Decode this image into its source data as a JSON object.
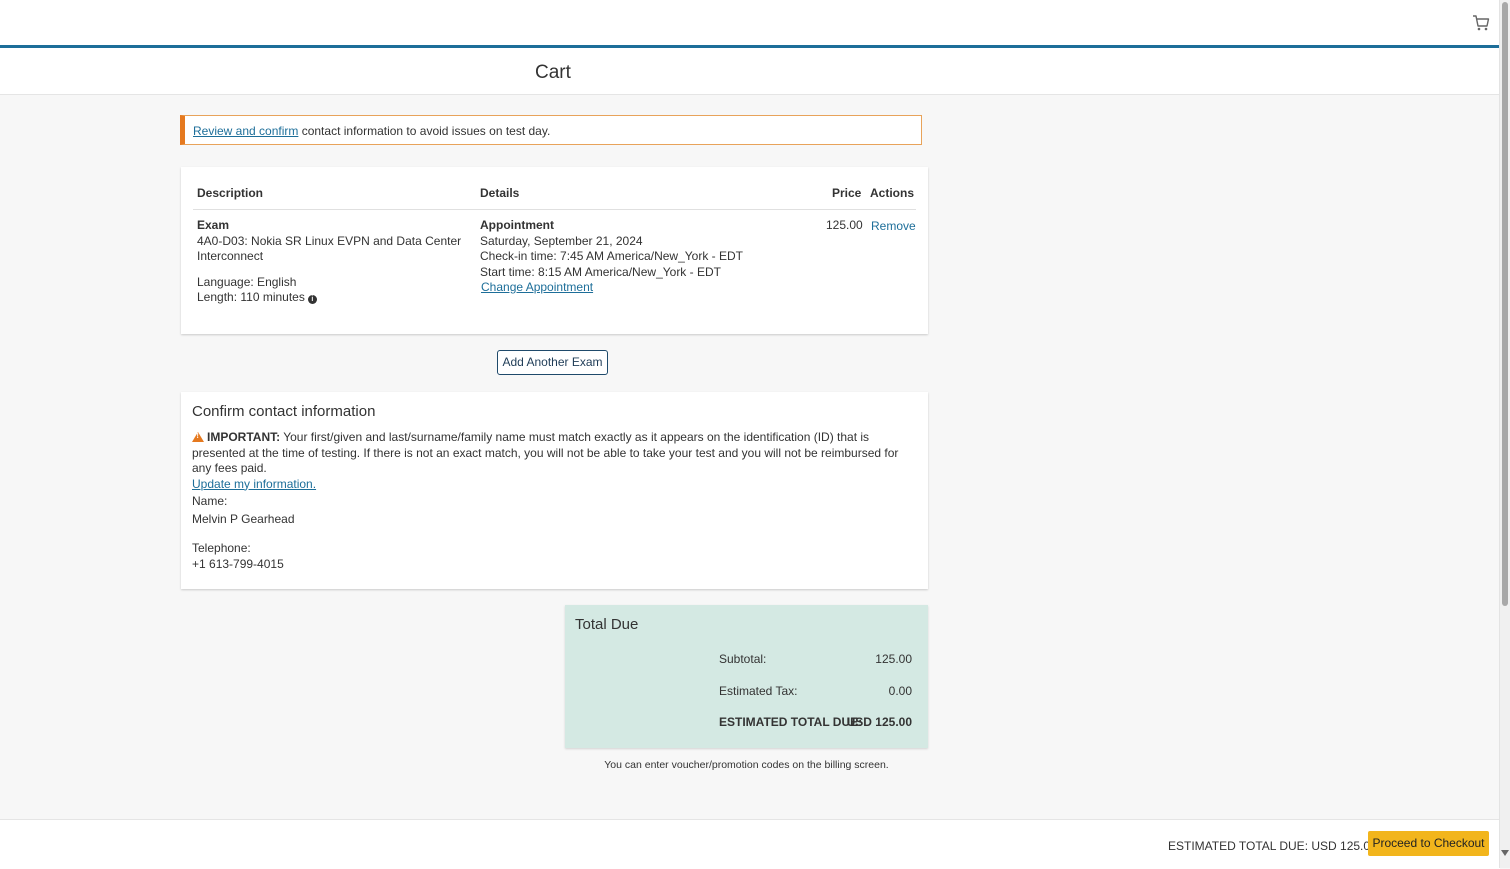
{
  "header": {
    "cart_icon": "shopping-cart-icon"
  },
  "page": {
    "title": "Cart"
  },
  "alert": {
    "link_text": "Review and confirm",
    "text": " contact information to avoid issues on test day."
  },
  "cart_table": {
    "headers": {
      "description": "Description",
      "details": "Details",
      "price": "Price",
      "actions": "Actions"
    },
    "item": {
      "type": "Exam",
      "name_line1": "4A0-D03: Nokia SR Linux EVPN and Data Center",
      "name_line2": "Interconnect",
      "language": "Language: English",
      "length": "Length: 110 minutes",
      "appointment_label": "Appointment",
      "date": "Saturday, September 21, 2024",
      "checkin": "Check-in time: 7:45 AM America/New_York - EDT",
      "start": "Start time: 8:15 AM America/New_York - EDT",
      "change_link": "Change Appointment",
      "price": "125.00",
      "remove": "Remove"
    }
  },
  "add_exam_button": "Add Another Exam",
  "contact": {
    "title": "Confirm contact information",
    "important_label": "IMPORTANT:",
    "important_text": " Your first/given and last/surname/family name must match exactly as it appears on the identification (ID) that is presented at the time of testing. If there is not an exact match, you will not be able to take your test and you will not be reimbursed for any fees paid.",
    "update_link": "Update my information.",
    "name_label": "Name:",
    "name_value": "Melvin P Gearhead",
    "phone_label": "Telephone:",
    "phone_value": "+1 613-799-4015"
  },
  "total": {
    "title": "Total Due",
    "subtotal_label": "Subtotal:",
    "subtotal_value": "125.00",
    "tax_label": "Estimated Tax:",
    "tax_value": "0.00",
    "due_label": "ESTIMATED TOTAL DUE:",
    "due_value": "USD 125.00",
    "voucher_note": "You can enter voucher/promotion codes on the billing screen."
  },
  "footer": {
    "total_text": "ESTIMATED TOTAL DUE: USD 125.00",
    "checkout_button": "Proceed to Checkout"
  },
  "colors": {
    "accent": "#1d6e99",
    "alert_border": "#e5791f",
    "total_bg": "#d4e9e3",
    "checkout_bg": "#f2b51c"
  }
}
